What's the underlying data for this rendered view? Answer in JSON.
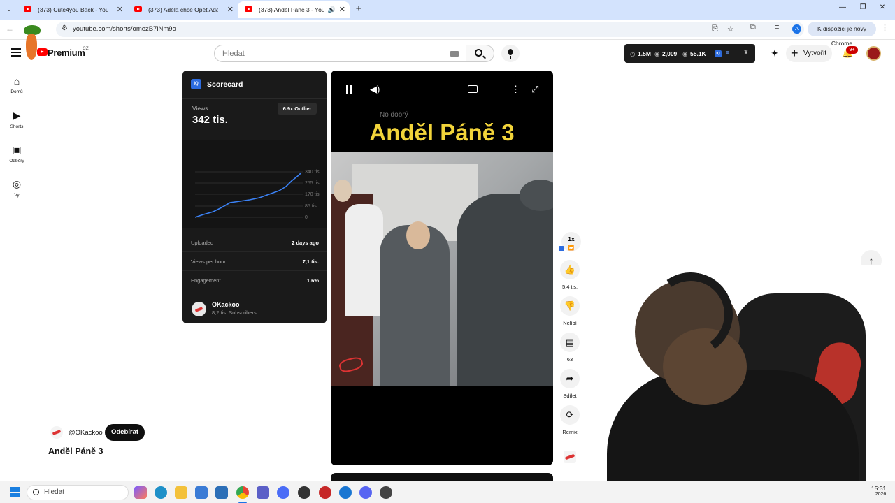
{
  "browser": {
    "tabs": [
      {
        "label": "(373) Cute4you Back - YouTube",
        "active": false
      },
      {
        "label": "(373) Adéla chce Opět Adama!",
        "active": false
      },
      {
        "label": "(373) Anděl Páně 3 - YouTube",
        "active": true
      }
    ],
    "url": "youtube.com/shorts/omezB7iNm9o",
    "profile_letter": "A",
    "new_chrome_label": "K dispozici je nový Chrome"
  },
  "youtube": {
    "logo_text": "Premium",
    "country_code": "CZ",
    "search_placeholder": "Hledat",
    "stats": {
      "subs": "1.5M",
      "videos": "2,009",
      "views": "55.1K"
    },
    "create_label": "Vytvořit",
    "notif_count": "9+"
  },
  "sidebar": {
    "items": [
      {
        "label": "Domů",
        "icon": "home-icon"
      },
      {
        "label": "Shorts",
        "icon": "shorts-icon"
      },
      {
        "label": "Odběry",
        "icon": "subscriptions-icon"
      },
      {
        "label": "Vy",
        "icon": "you-icon"
      }
    ]
  },
  "scorecard": {
    "title": "Scorecard",
    "logo": "IQ",
    "views_label": "Views",
    "views_value": "342 tis.",
    "outlier": "6.9x Outlier",
    "chart_ticks": [
      "340 tis.",
      "255 tis.",
      "170 tis.",
      "85 tis.",
      "0"
    ],
    "rows": [
      {
        "label": "Uploaded",
        "value": "2 days ago"
      },
      {
        "label": "Views per hour",
        "value": "7,1 tis."
      },
      {
        "label": "Engagement",
        "value": "1.6%"
      }
    ],
    "channel": {
      "name": "OKackoo",
      "subs": "8,2 tis. Subscribers"
    }
  },
  "player": {
    "subtitle": "No dobrý",
    "title_overlay": "Anděl Páně 3"
  },
  "actions": {
    "speed": "1x",
    "like_count": "5,4 tis.",
    "dislike_label": "Nelíbí",
    "comments_count": "63",
    "share_label": "Sdílet",
    "remix_label": "Remix"
  },
  "short_info": {
    "handle": "@OKackoo",
    "subscribe_label": "Odebírat",
    "title": "Anděl Páně 3"
  },
  "taskbar": {
    "search_placeholder": "Hledat",
    "time": "15:31",
    "year": "2026"
  },
  "colors": {
    "title_yellow": "#f2d43a",
    "accent_blue": "#2d6cdf",
    "youtube_red": "#ff0000"
  }
}
